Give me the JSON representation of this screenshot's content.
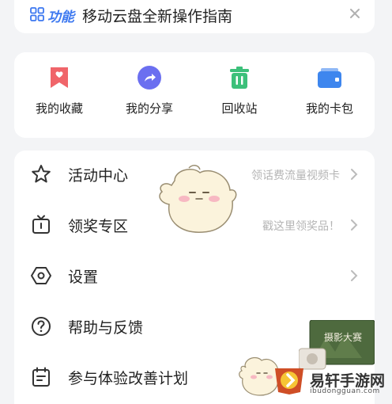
{
  "banner": {
    "tag": "功能",
    "text": "移动云盘全新操作指南",
    "close_icon": "close-icon"
  },
  "quick_actions": [
    {
      "label": "我的收藏",
      "icon": "bookmark-icon",
      "color": "#f0656a"
    },
    {
      "label": "我的分享",
      "icon": "share-icon",
      "color": "#6b6ff0"
    },
    {
      "label": "回收站",
      "icon": "trash-icon",
      "color": "#3cc07a"
    },
    {
      "label": "我的卡包",
      "icon": "wallet-icon",
      "color": "#3e86ee"
    }
  ],
  "menu": [
    {
      "label": "活动中心",
      "hint": "领话费流量视频卡",
      "icon": "star-icon"
    },
    {
      "label": "领奖专区",
      "hint": "戳这里领奖品！",
      "icon": "gift-box-icon"
    },
    {
      "label": "设置",
      "hint": "",
      "icon": "settings-hexagon-icon"
    },
    {
      "label": "帮助与反馈",
      "hint": "",
      "icon": "help-icon"
    },
    {
      "label": "参与体验改善计划",
      "hint": "",
      "icon": "plan-icon"
    }
  ],
  "watermark": {
    "title": "易轩手游网",
    "url": "ibudongguan.com",
    "badge_text": "摄影大赛"
  },
  "colors": {
    "accent": "#3c78f0",
    "background": "#f3f4f6"
  }
}
